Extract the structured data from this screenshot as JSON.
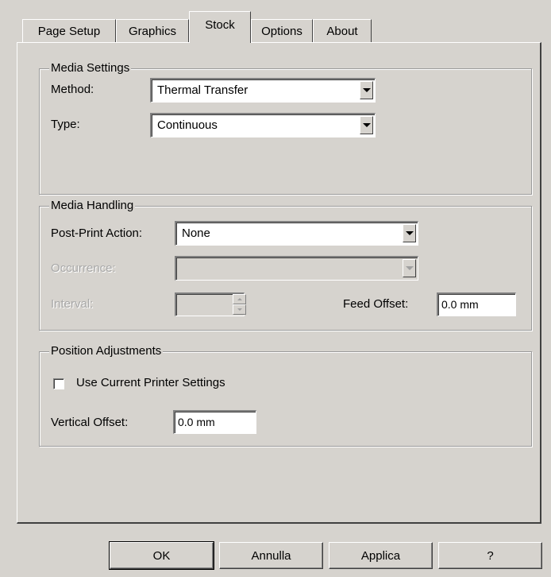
{
  "tabs": [
    {
      "label": "Page Setup",
      "active": false
    },
    {
      "label": "Graphics",
      "active": false
    },
    {
      "label": "Stock",
      "active": true
    },
    {
      "label": "Options",
      "active": false
    },
    {
      "label": "About",
      "active": false
    }
  ],
  "media_settings": {
    "legend": "Media Settings",
    "method_label": "Method:",
    "method_value": "Thermal Transfer",
    "type_label": "Type:",
    "type_value": "Continuous"
  },
  "media_handling": {
    "legend": "Media Handling",
    "post_print_label": "Post-Print Action:",
    "post_print_value": "None",
    "occurrence_label": "Occurrence:",
    "occurrence_value": "",
    "interval_label": "Interval:",
    "interval_value": "",
    "feed_offset_label": "Feed Offset:",
    "feed_offset_value": "0.0 mm"
  },
  "position_adjustments": {
    "legend": "Position Adjustments",
    "use_current_label": "Use Current Printer Settings",
    "use_current_checked": false,
    "vertical_offset_label": "Vertical Offset:",
    "vertical_offset_value": "0.0 mm"
  },
  "buttons": {
    "ok": "OK",
    "cancel": "Annulla",
    "apply": "Applica",
    "help": "?"
  }
}
